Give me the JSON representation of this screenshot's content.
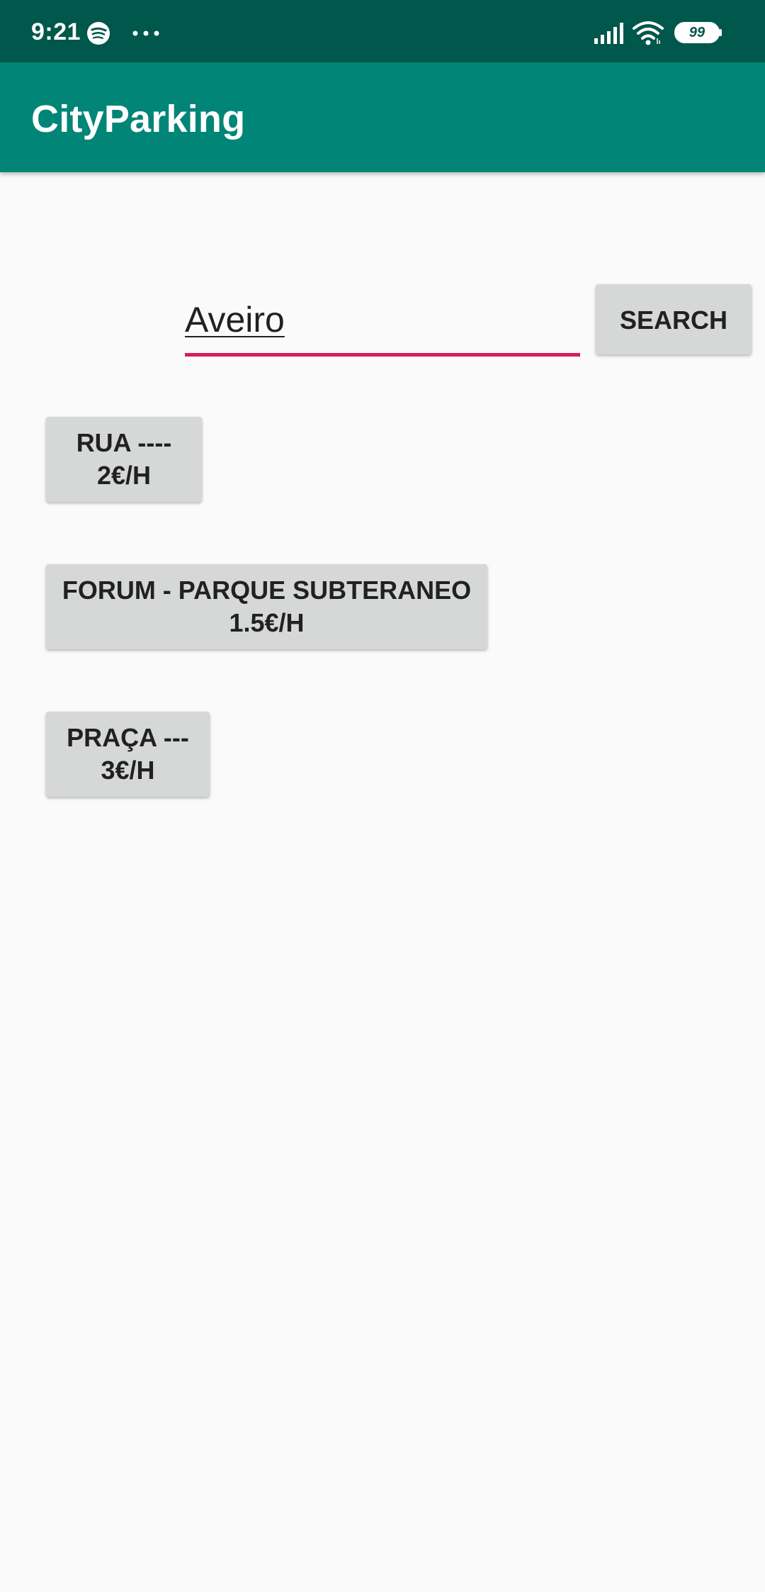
{
  "status_bar": {
    "time": "9:21",
    "battery_level": "99",
    "icons": [
      "spotify-icon",
      "more-icon",
      "signal-icon",
      "wifi-icon",
      "battery-icon"
    ]
  },
  "app_bar": {
    "title": "CityParking"
  },
  "search": {
    "value": "Aveiro",
    "button_label": "SEARCH"
  },
  "results": [
    {
      "name": "RUA ----",
      "price": "2€/H"
    },
    {
      "name": "FORUM - PARQUE SUBTERANEO",
      "price": "1.5€/H"
    },
    {
      "name": "PRAÇA ---",
      "price": "3€/H"
    }
  ],
  "colors": {
    "status_bar": "#00574b",
    "app_bar": "#008577",
    "accent": "#d81b60",
    "button": "#d6d7d7",
    "background": "#fafafa"
  }
}
